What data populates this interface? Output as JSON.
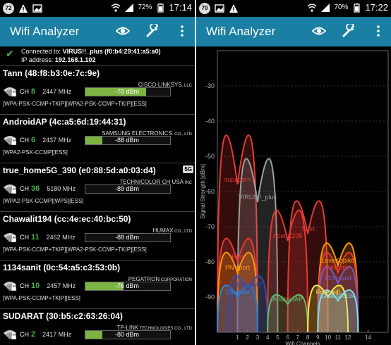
{
  "left": {
    "status": {
      "notif": "72",
      "battery": "72%",
      "time": "17:14"
    },
    "app_title": "Wifi Analyzer",
    "connected": {
      "prefix": "Connected to:",
      "ssid": "VIRUS!!_plus (f0:b4:29:41:a5:a0)",
      "ip_label": "IP address:",
      "ip": "192.168.1.102"
    },
    "aps": [
      {
        "name": "Tann (48:f8:b3:0e:7c:9e)",
        "ch": "8",
        "freq": "2447 MHz",
        "vendor": "CISCO-LINKSYS",
        "vendor_suffix": ", LLC",
        "dbm": "-70 dBm",
        "level": 0.72,
        "caps": "[WPA-PSK-CCMP+TKIP][WPA2-PSK-CCMP+TKIP][ESS]",
        "band5": ""
      },
      {
        "name": "AndroidAP (4c:a5:6d:19:44:31)",
        "ch": "6",
        "freq": "2437 MHz",
        "vendor": "SAMSUNG ELECTRONICS",
        "vendor_suffix": ". CO., LTD",
        "dbm": "-88 dBm",
        "level": 0.2,
        "caps": "[WPA2-PSK-CCMP][ESS]",
        "band5": ""
      },
      {
        "name": "true_home5G_390 (e0:88:5d:a0:03:d4)",
        "ch": "36",
        "freq": "5180 MHz",
        "vendor": "TECHNICOLOR CH USA",
        "vendor_suffix": " INC",
        "dbm": "-89 dBm",
        "level": 0.0,
        "caps": "[WPA2-PSK-CCMP][WPS][ESS]",
        "band5": "5G"
      },
      {
        "name": "Chawalit194 (cc:4e:ec:40:bc:50)",
        "ch": "11",
        "freq": "2462 MHz",
        "vendor": "HUMAX",
        "vendor_suffix": " CO., LTD",
        "dbm": "-88 dBm",
        "level": 0.0,
        "caps": "[WPA-PSK-CCMP+TKIP][WPA2-PSK-CCMP+TKIP][ESS]",
        "band5": ""
      },
      {
        "name": "1134sanit (0c:54:a5:c3:53:0b)",
        "ch": "10",
        "freq": "2457 MHz",
        "vendor": "PEGATRON",
        "vendor_suffix": " CORPORATION",
        "dbm": "-76 dBm",
        "level": 0.45,
        "caps": "[WPA-PSK-CCMP+TKIP][ESS]",
        "band5": ""
      },
      {
        "name": "SUDARAT (30:b5:c2:63:26:04)",
        "ch": "2",
        "freq": "2417 MHz",
        "vendor": "TP-LINK",
        "vendor_suffix": " TECHNOLOGIES CO., LTD",
        "dbm": "-80 dBm",
        "level": 0.2,
        "caps": "",
        "band5": ""
      }
    ]
  },
  "right": {
    "status": {
      "notif": "70",
      "battery": "70%",
      "time": "17:22"
    },
    "app_title": "Wifi Analyzer",
    "chart_data": {
      "type": "line",
      "ylabel": "Signal Strength [dBm]",
      "xlabel": "Wifi Channels",
      "ylim": [
        -100,
        -20
      ],
      "yticks": [
        "-30",
        "-40",
        "-50",
        "-60",
        "-70",
        "-80",
        "-90"
      ],
      "xticks": [
        "1",
        "2",
        "3",
        "4",
        "5",
        "6",
        "7",
        "8",
        "9",
        "10",
        "11",
        "12",
        "14"
      ],
      "series": [
        {
          "name": "supaporn",
          "channel": 1,
          "dbm": -58,
          "color": "#e53935"
        },
        {
          "name": "VIRUS!!_plus",
          "channel": 3,
          "dbm": -63,
          "color": "#9e9e9e"
        },
        {
          "name": "Acer Z205",
          "channel": 6,
          "dbm": -74,
          "color": "#e53935"
        },
        {
          "name": "Tann",
          "channel": 8,
          "dbm": -72,
          "color": "#e53935"
        },
        {
          "name": "Bird",
          "channel": 1,
          "dbm": -80,
          "color": "#e53935"
        },
        {
          "name": "PN sport",
          "channel": 1,
          "dbm": -83,
          "color": "#ff9800"
        },
        {
          "name": "Chawalit",
          "channel": 1,
          "dbm": -90,
          "color": "#1e88e5"
        },
        {
          "name": "SUDARAT",
          "channel": 2,
          "dbm": -88,
          "color": "#3949ab"
        },
        {
          "name": "AndroidAP",
          "channel": 6,
          "dbm": -92,
          "color": "#66bb6a"
        },
        {
          "name": "LoveKopiko",
          "channel": 11,
          "dbm": -81,
          "color": "#ff9800"
        },
        {
          "name": "Mikrotik",
          "channel": 11,
          "dbm": -83,
          "color": "#e53935"
        },
        {
          "name": "1134sanit",
          "channel": 11,
          "dbm": -86,
          "color": "#7e57c2"
        },
        {
          "name": "Free wifi",
          "channel": 10,
          "dbm": -90,
          "color": "#ffeb3b"
        },
        {
          "name": "Chawalit194",
          "channel": 11,
          "dbm": -91,
          "color": "#80deea"
        }
      ]
    }
  }
}
